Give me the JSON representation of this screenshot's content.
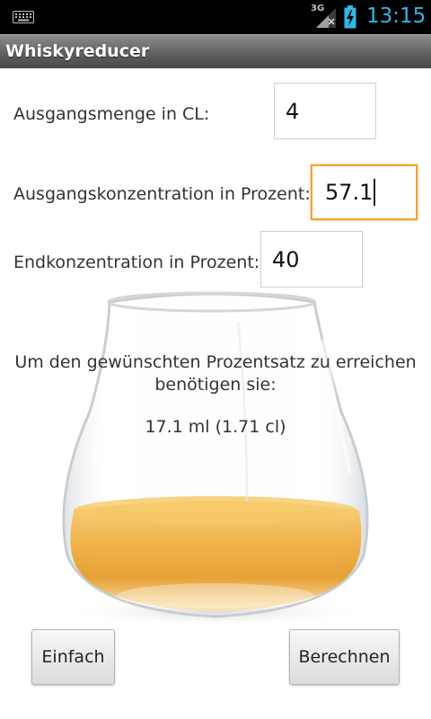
{
  "status_bar": {
    "network": "3G",
    "time": "13:15",
    "icons": [
      "keyboard-icon",
      "signal-icon",
      "battery-charging-icon"
    ]
  },
  "app": {
    "title": "Whiskyreducer"
  },
  "form": {
    "start_amount_label": "Ausgangsmenge in CL:",
    "start_amount_value": "4",
    "start_concentration_label": "Ausgangskonzentration in Prozent:",
    "start_concentration_value": "57.1",
    "end_concentration_label": "Endkonzentration in Prozent:",
    "end_concentration_value": "40"
  },
  "result": {
    "line1": "Um den gewünschten Prozentsatz zu erreichen",
    "line2": "benötigen sie:",
    "value": "17.1 ml (1.71 cl)"
  },
  "buttons": {
    "simple": "Einfach",
    "calculate": "Berechnen"
  },
  "colors": {
    "clock": "#33b5e5",
    "focus_border": "#f4a233",
    "whisky": "#e8a030"
  }
}
